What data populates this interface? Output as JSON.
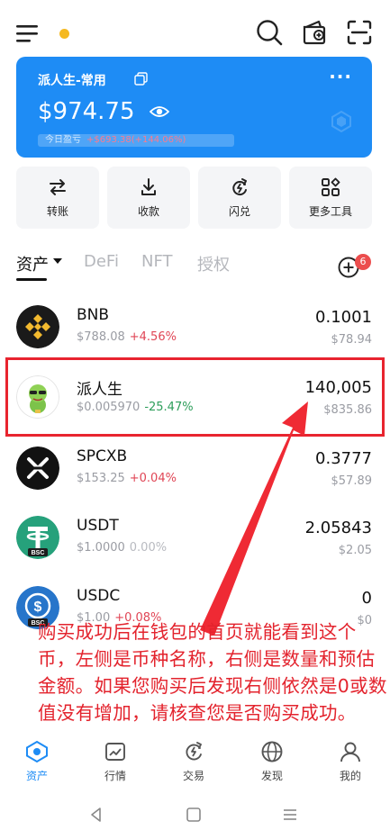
{
  "header": {
    "menu_icon": "menu-icon",
    "status_dot_color": "#f5b921",
    "right_icons": [
      "search-icon",
      "wallet-add-icon",
      "scan-icon"
    ]
  },
  "wallet": {
    "name": "派人生-常用",
    "balance": "$974.75",
    "pnl_label": "今日盈亏",
    "pnl_value": "+$693.38(+144.06%)",
    "more_label": "···",
    "accent_color": "#1e8cf5"
  },
  "quick_actions": [
    {
      "label": "转账",
      "icon": "transfer-icon"
    },
    {
      "label": "收款",
      "icon": "receive-icon"
    },
    {
      "label": "闪兑",
      "icon": "swap-icon"
    },
    {
      "label": "更多工具",
      "icon": "tools-icon"
    }
  ],
  "tabs": [
    {
      "label": "资产",
      "active": true
    },
    {
      "label": "DeFi",
      "active": false
    },
    {
      "label": "NFT",
      "active": false
    },
    {
      "label": "授权",
      "active": false
    }
  ],
  "add_token_badge": "6",
  "tokens": [
    {
      "name": "BNB",
      "price": "$788.08",
      "change": "+4.56%",
      "change_dir": "up",
      "amount": "0.1001",
      "value": "$78.94",
      "logo": "bnb-logo"
    },
    {
      "name": "派人生",
      "price": "$0.005970",
      "change": "-25.47%",
      "change_dir": "down",
      "amount": "140,005",
      "value": "$835.86",
      "logo": "pairensheng-logo"
    },
    {
      "name": "SPCXB",
      "price": "$153.25",
      "change": "+0.04%",
      "change_dir": "up",
      "amount": "0.3777",
      "value": "$57.89",
      "logo": "spcxb-logo"
    },
    {
      "name": "USDT",
      "price": "$1.0000",
      "change": "0.00%",
      "change_dir": "flat",
      "amount": "2.05843",
      "value": "$2.05",
      "logo": "usdt-logo"
    },
    {
      "name": "USDC",
      "price": "$1.00",
      "change": "+0.08%",
      "change_dir": "up",
      "amount": "0",
      "value": "$0",
      "logo": "usdc-logo"
    }
  ],
  "annotation": "购买成功后在钱包的首页就能看到这个币，左侧是币种名称，右侧是数量和预估金额。如果您购买后发现右侧依然是0或数值没有增加，请核查您是否购买成功。",
  "bottom_nav": [
    {
      "label": "资产",
      "icon": "assets-icon",
      "active": true
    },
    {
      "label": "行情",
      "icon": "market-icon",
      "active": false
    },
    {
      "label": "交易",
      "icon": "trade-icon",
      "active": false
    },
    {
      "label": "发现",
      "icon": "discover-icon",
      "active": false
    },
    {
      "label": "我的",
      "icon": "profile-icon",
      "active": false
    }
  ],
  "system_nav": [
    "back-icon",
    "home-icon",
    "recents-icon"
  ]
}
